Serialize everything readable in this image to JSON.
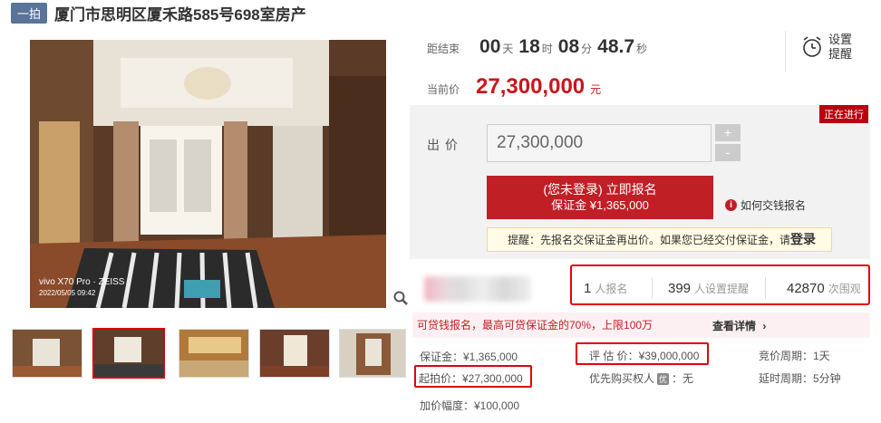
{
  "header": {
    "round_badge": "一拍",
    "title": "厦门市思明区厦禾路585号698室房产"
  },
  "gallery": {
    "watermark_line1": "vivo X70 Pro · ZEISS",
    "watermark_line2": "2022/05/05 09:42",
    "thumbnail_count": 5,
    "active_thumbnail_index": 1
  },
  "timer": {
    "label": "距结束",
    "days": "00",
    "days_unit": "天",
    "hours": "18",
    "hours_unit": "时",
    "minutes": "08",
    "minutes_unit": "分",
    "seconds": "48.7",
    "seconds_unit": "秒"
  },
  "current_price": {
    "label": "当前价",
    "value": "27,300,000",
    "unit": "元"
  },
  "reminder": {
    "label": "设置提醒"
  },
  "bid": {
    "status": "正在进行",
    "label": "出价",
    "input_value": "27,300,000",
    "plus": "+",
    "minus": "-",
    "signup_line1": "(您未登录) 立即报名",
    "signup_line2": "保证金 ¥1,365,000",
    "how_to_pay": "如何交钱报名",
    "notice_text": "提醒：先报名交保证金再出价。如果您已经交付保证金，请",
    "notice_login": "登录"
  },
  "stats": {
    "registered_count": "1",
    "registered_label": "人报名",
    "reminder_count": "399",
    "reminder_label": "人设置提醒",
    "views_count": "42870",
    "views_label": "次围观"
  },
  "loan": {
    "text": "可贷钱报名，最高可贷保证金的70%，上限100万",
    "link": "查看详情"
  },
  "details": {
    "deposit": "保证金：¥1,365,000",
    "appraisal": "评 估 价：¥39,000,000",
    "bid_cycle": "竞价周期：1天",
    "starting_price": "起拍价：¥27,300,000",
    "priority_label": "优先购买权人",
    "priority_value": "无",
    "priority_badge": "优",
    "extension": "延时周期：5分钟",
    "increment": "加价幅度：¥100,000"
  },
  "colors": {
    "accent_red": "#c01f26",
    "highlight_border": "#e1000f",
    "badge_blue": "#5a7399"
  }
}
